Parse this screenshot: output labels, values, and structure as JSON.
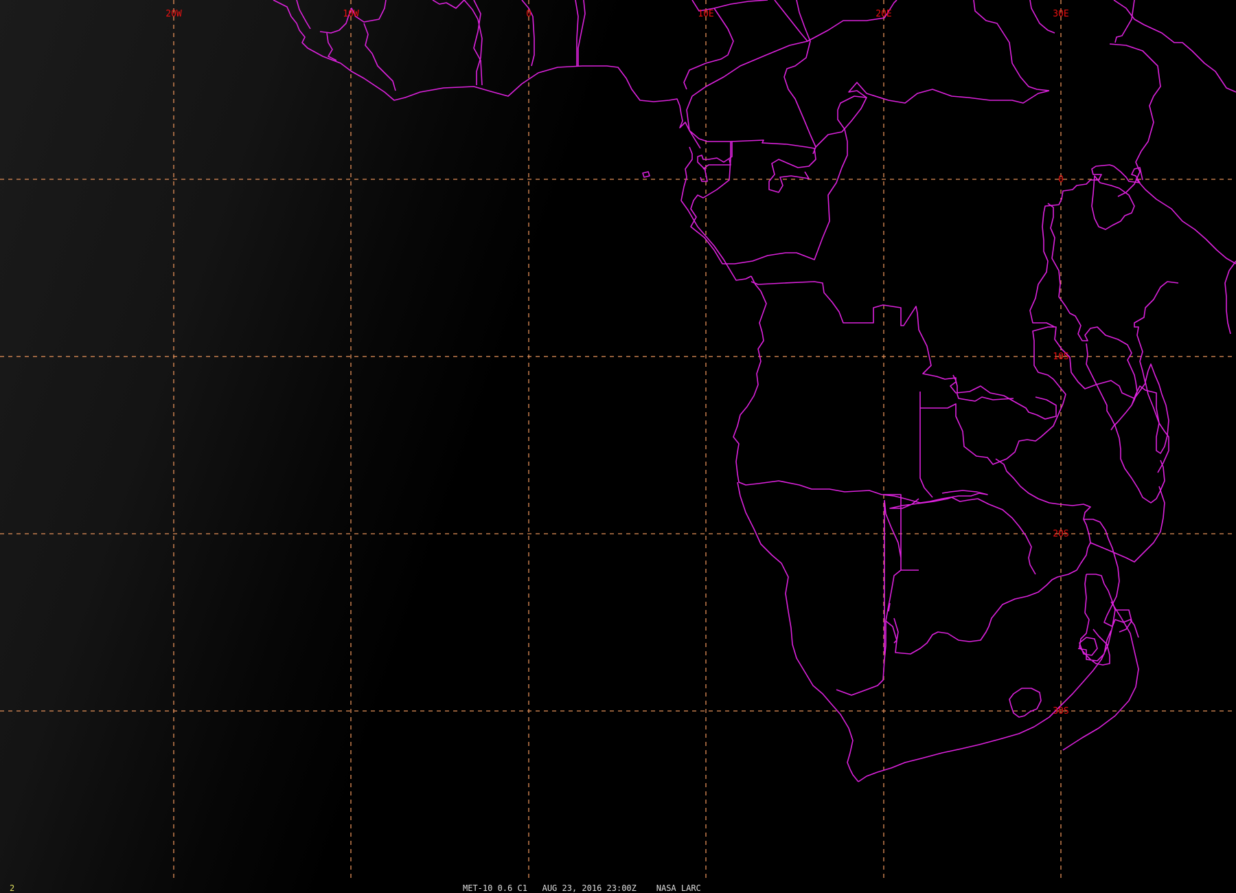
{
  "map": {
    "background_color": "#000000",
    "grid_color": "#e8925a",
    "label_color": "#ee1111",
    "coast_color": "#dd22dd",
    "sunlit_side": "west",
    "longitude_labels": [
      "20W",
      "10W",
      "0",
      "10E",
      "20E",
      "30E"
    ],
    "latitude_labels": [
      "0",
      "10S",
      "20S",
      "30S"
    ]
  },
  "footer": {
    "caption": "MET-10 0.6 C1   AUG 23, 2016 23:00Z    NASA LARC",
    "caption_color": "#dddddd",
    "frame_number": "2",
    "frame_number_color": "#e0e060"
  }
}
